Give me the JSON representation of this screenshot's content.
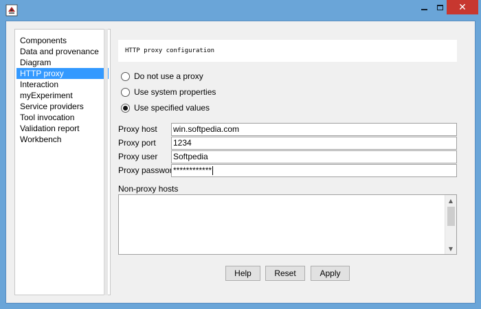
{
  "window": {
    "app_icon": "java-cup-icon",
    "close_symbol": "✕"
  },
  "sidebar": {
    "items": [
      {
        "label": "Components"
      },
      {
        "label": "Data and provenance"
      },
      {
        "label": "Diagram"
      },
      {
        "label": "HTTP proxy",
        "selected": true
      },
      {
        "label": "Interaction"
      },
      {
        "label": "myExperiment"
      },
      {
        "label": "Service providers"
      },
      {
        "label": "Tool invocation"
      },
      {
        "label": "Validation report"
      },
      {
        "label": "Workbench"
      }
    ]
  },
  "panel": {
    "header": "HTTP proxy configuration",
    "radios": [
      {
        "label": "Do not use a proxy",
        "checked": false
      },
      {
        "label": "Use system properties",
        "checked": false
      },
      {
        "label": "Use specified values",
        "checked": true
      }
    ],
    "fields": {
      "host_label": "Proxy host",
      "host_value": "win.softpedia.com",
      "port_label": "Proxy port",
      "port_value": "1234",
      "user_label": "Proxy user",
      "user_value": "Softpedia",
      "password_label": "Proxy password",
      "password_value": "************"
    },
    "nonproxy_label": "Non-proxy hosts",
    "nonproxy_value": ""
  },
  "buttons": {
    "help": "Help",
    "reset": "Reset",
    "apply": "Apply"
  },
  "colors": {
    "titlebar": "#6aa5d8",
    "selection": "#3399ff",
    "close": "#c7372f"
  }
}
